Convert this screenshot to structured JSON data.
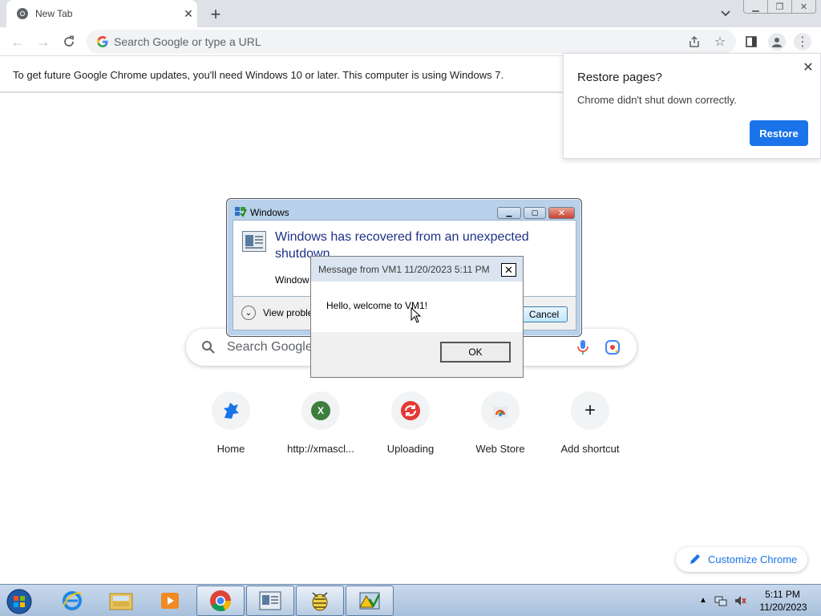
{
  "browser": {
    "tab_title": "New Tab",
    "newtab_icon": "plus-icon",
    "omnibox_placeholder": "Search Google or type a URL",
    "window_controls": [
      "minimize",
      "restore",
      "close"
    ]
  },
  "infobar": {
    "message": "To get future Google Chrome updates, you'll need Windows 10 or later. This computer is using Windows 7."
  },
  "restore_bubble": {
    "title": "Restore pages?",
    "message": "Chrome didn't shut down correctly.",
    "button": "Restore",
    "close": "✕"
  },
  "ntp": {
    "search_placeholder": "Search Google",
    "shortcuts": [
      {
        "label": "Home",
        "icon": "dinosaur-icon"
      },
      {
        "label": "http://xmascl...",
        "icon": "letter-x-icon",
        "letter": "X"
      },
      {
        "label": "Uploading",
        "icon": "sync-icon"
      },
      {
        "label": "Web Store",
        "icon": "chrome-webstore-icon"
      },
      {
        "label": "Add shortcut",
        "icon": "plus-icon"
      }
    ],
    "customize": "Customize Chrome"
  },
  "windows_dialog": {
    "title": "Windows",
    "heading": "Windows has recovered from an unexpected shutdown",
    "sub": "Window",
    "view_problems": "View proble",
    "cancel": "Cancel"
  },
  "message_box": {
    "title": "Message from VM1 11/20/2023 5:11 PM",
    "text": "Hello, welcome to VM1!",
    "ok": "OK",
    "close": "✕"
  },
  "taskbar": {
    "items": [
      "start",
      "internet-explorer",
      "file-explorer",
      "media-player",
      "chrome",
      "windows-dialog",
      "bug-app",
      "problem-reporting"
    ],
    "time": "5:11 PM",
    "date": "11/20/2023"
  },
  "colors": {
    "accent": "#1a73e8",
    "chrome_bg": "#dee1e6",
    "taskbar": "#b3c8e2"
  }
}
